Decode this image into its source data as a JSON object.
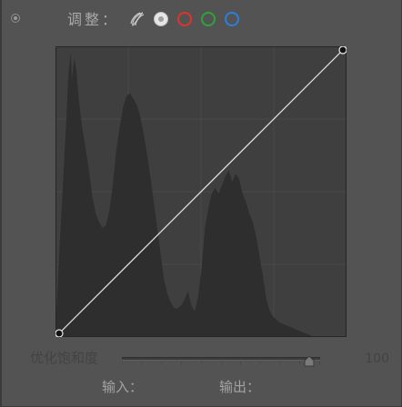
{
  "header": {
    "adjust_label": "调整："
  },
  "channels": [
    {
      "name": "composite",
      "icon": "rgb-composite-icon"
    },
    {
      "name": "luminance",
      "icon": "luminance-icon",
      "selected": true
    },
    {
      "name": "red",
      "icon": "red-channel-icon",
      "color": "#e0332b"
    },
    {
      "name": "green",
      "icon": "green-channel-icon",
      "color": "#2ea43a"
    },
    {
      "name": "blue",
      "icon": "blue-channel-icon",
      "color": "#2f7ddf"
    }
  ],
  "curve": {
    "points": [
      [
        0,
        0
      ],
      [
        255,
        255
      ]
    ],
    "histogram": [
      [
        0,
        0.05
      ],
      [
        3,
        0.3
      ],
      [
        6,
        0.52
      ],
      [
        9,
        0.75
      ],
      [
        11,
        0.92
      ],
      [
        13,
        0.99
      ],
      [
        14,
        0.9
      ],
      [
        16,
        0.97
      ],
      [
        18,
        0.93
      ],
      [
        20,
        0.83
      ],
      [
        23,
        0.73
      ],
      [
        26,
        0.66
      ],
      [
        29,
        0.58
      ],
      [
        32,
        0.49
      ],
      [
        35,
        0.43
      ],
      [
        38,
        0.4
      ],
      [
        41,
        0.38
      ],
      [
        44,
        0.39
      ],
      [
        47,
        0.44
      ],
      [
        50,
        0.53
      ],
      [
        53,
        0.65
      ],
      [
        56,
        0.73
      ],
      [
        59,
        0.8
      ],
      [
        62,
        0.84
      ],
      [
        65,
        0.85
      ],
      [
        68,
        0.83
      ],
      [
        71,
        0.81
      ],
      [
        74,
        0.77
      ],
      [
        77,
        0.71
      ],
      [
        80,
        0.64
      ],
      [
        83,
        0.56
      ],
      [
        86,
        0.47
      ],
      [
        89,
        0.38
      ],
      [
        92,
        0.29
      ],
      [
        95,
        0.2
      ],
      [
        98,
        0.15
      ],
      [
        101,
        0.12
      ],
      [
        104,
        0.1
      ],
      [
        107,
        0.1
      ],
      [
        110,
        0.11
      ],
      [
        113,
        0.13
      ],
      [
        116,
        0.16
      ],
      [
        119,
        0.11
      ],
      [
        122,
        0.09
      ],
      [
        125,
        0.14
      ],
      [
        128,
        0.24
      ],
      [
        131,
        0.38
      ],
      [
        134,
        0.45
      ],
      [
        137,
        0.5
      ],
      [
        140,
        0.52
      ],
      [
        143,
        0.5
      ],
      [
        146,
        0.53
      ],
      [
        149,
        0.56
      ],
      [
        152,
        0.58
      ],
      [
        155,
        0.54
      ],
      [
        158,
        0.57
      ],
      [
        161,
        0.55
      ],
      [
        164,
        0.5
      ],
      [
        167,
        0.47
      ],
      [
        170,
        0.43
      ],
      [
        173,
        0.4
      ],
      [
        176,
        0.35
      ],
      [
        179,
        0.28
      ],
      [
        182,
        0.21
      ],
      [
        185,
        0.13
      ],
      [
        188,
        0.09
      ],
      [
        191,
        0.07
      ],
      [
        194,
        0.06
      ],
      [
        197,
        0.05
      ],
      [
        200,
        0.045
      ],
      [
        203,
        0.04
      ],
      [
        206,
        0.035
      ],
      [
        209,
        0.03
      ],
      [
        212,
        0.025
      ],
      [
        215,
        0.02
      ],
      [
        218,
        0.015
      ],
      [
        221,
        0.01
      ],
      [
        224,
        0.005
      ],
      [
        226,
        0
      ]
    ]
  },
  "saturation": {
    "label": "优化饱和度",
    "value_text": "100",
    "value": 100,
    "max": 100
  },
  "readout": {
    "input_label": "输入：",
    "output_label": "输出："
  }
}
